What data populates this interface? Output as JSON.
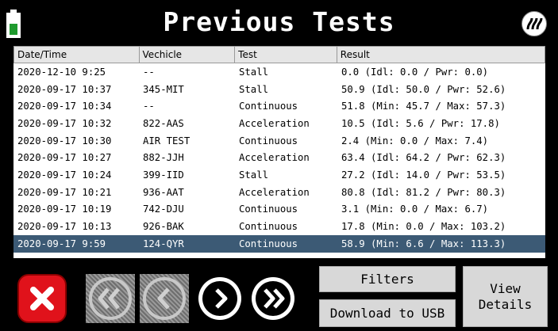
{
  "header": {
    "title": "Previous Tests",
    "battery_icon": "battery-icon",
    "heat_icon": "heat-icon"
  },
  "table": {
    "columns": [
      "Date/Time",
      "Vechicle",
      "Test",
      "Result"
    ],
    "rows": [
      {
        "date": "2020-12-10 9:25",
        "vehicle": "--",
        "test": "Stall",
        "result": "0.0 (Idl: 0.0 / Pwr: 0.0)"
      },
      {
        "date": "2020-09-17 10:37",
        "vehicle": "345-MIT",
        "test": "Stall",
        "result": "50.9 (Idl: 50.0 / Pwr: 52.6)"
      },
      {
        "date": "2020-09-17 10:34",
        "vehicle": "--",
        "test": "Continuous",
        "result": "51.8 (Min: 45.7 / Max: 57.3)"
      },
      {
        "date": "2020-09-17 10:32",
        "vehicle": "822-AAS",
        "test": "Acceleration",
        "result": "10.5 (Idl: 5.6 / Pwr: 17.8)"
      },
      {
        "date": "2020-09-17 10:30",
        "vehicle": "AIR TEST",
        "test": "Continuous",
        "result": "2.4 (Min: 0.0 / Max: 7.4)"
      },
      {
        "date": "2020-09-17 10:27",
        "vehicle": "882-JJH",
        "test": "Acceleration",
        "result": "63.4 (Idl: 64.2 / Pwr: 62.3)"
      },
      {
        "date": "2020-09-17 10:24",
        "vehicle": "399-IID",
        "test": "Stall",
        "result": "27.2 (Idl: 14.0 / Pwr: 53.5)"
      },
      {
        "date": "2020-09-17 10:21",
        "vehicle": "936-AAT",
        "test": "Acceleration",
        "result": "80.8 (Idl: 81.2 / Pwr: 80.3)"
      },
      {
        "date": "2020-09-17 10:19",
        "vehicle": "742-DJU",
        "test": "Continuous",
        "result": "3.1 (Min: 0.0 / Max: 6.7)"
      },
      {
        "date": "2020-09-17 10:13",
        "vehicle": "926-BAK",
        "test": "Continuous",
        "result": "17.8 (Min: 0.0 / Max: 103.2)"
      },
      {
        "date": "2020-09-17 9:59",
        "vehicle": "124-QYR",
        "test": "Continuous",
        "result": "58.9 (Min: 6.6 / Max: 113.3)",
        "selected": true
      }
    ]
  },
  "buttons": {
    "close_icon": "close-icon",
    "first_icon": "double-chevron-left-icon",
    "prev_icon": "chevron-left-icon",
    "next_icon": "chevron-right-icon",
    "last_icon": "double-chevron-right-icon",
    "filters": "Filters",
    "download": "Download to USB",
    "view_details_line1": "View",
    "view_details_line2": "Details"
  },
  "colors": {
    "selected_row": "#3c5a75",
    "close": "#e0121b",
    "battery": "#1f9a2e"
  }
}
